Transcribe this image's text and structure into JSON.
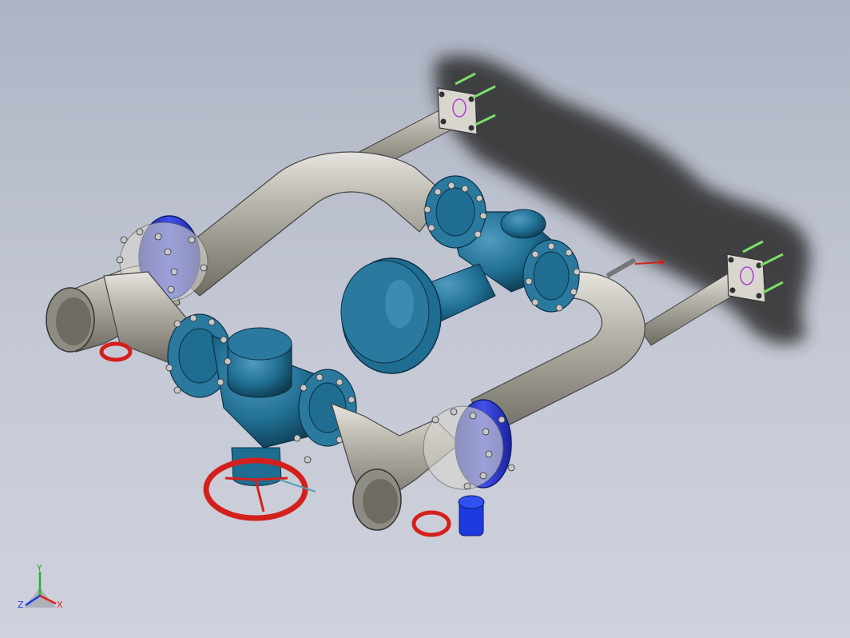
{
  "viewport": {
    "background_top": "#aeb4c4",
    "background_bottom": "#cfd2dc",
    "model": "pipe-assembly"
  },
  "colors": {
    "pipe_steel": "#b9b6ad",
    "valve_body": "#1f6d90",
    "flange_ring": "#2f3ec8",
    "handwheel": "#d4201c",
    "bolt": "#c8c8c8",
    "shadow": "#2a2a2a",
    "mount_marker": "#7ddc6a"
  },
  "triad": {
    "x_label": "X",
    "y_label": "Y",
    "z_label": "Z",
    "x_color": "#e0201c",
    "y_color": "#22b02a",
    "z_color": "#1c3ae0"
  }
}
